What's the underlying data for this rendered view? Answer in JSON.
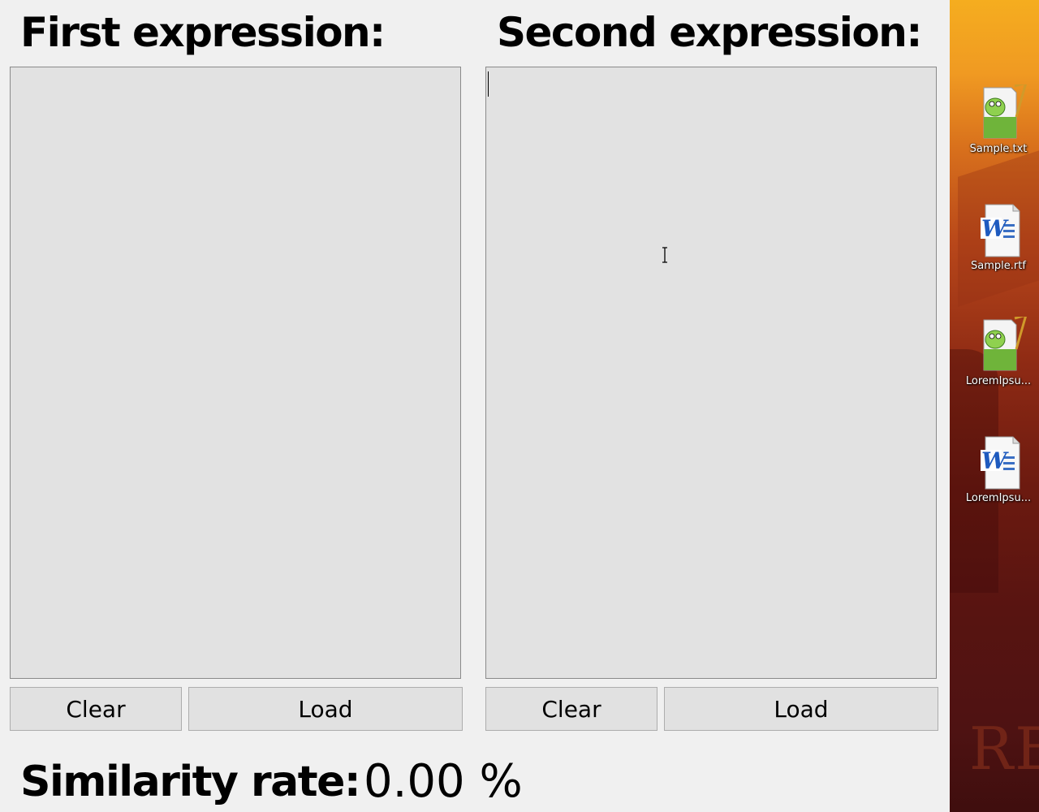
{
  "app": {
    "first_heading": "First expression:",
    "second_heading": "Second expression:",
    "first_panel": {
      "text": "",
      "clear_label": "Clear",
      "load_label": "Load"
    },
    "second_panel": {
      "text": "",
      "clear_label": "Clear",
      "load_label": "Load"
    },
    "similarity_label": "Similarity rate:",
    "similarity_value": "0.00 %"
  },
  "desktop": {
    "icons": [
      {
        "label": "Sample.txt",
        "icon": "notepad-plus-plus-icon"
      },
      {
        "label": "Sample.rtf",
        "icon": "word-document-icon"
      },
      {
        "label": "LoremIpsu...",
        "icon": "notepad-plus-plus-icon"
      },
      {
        "label": "LoremIpsu...",
        "icon": "word-document-icon"
      }
    ],
    "wallpaper_text": "RE",
    "colors": {
      "wallpaper_top": "#f5ad1f",
      "wallpaper_bottom": "#3f0e0e"
    }
  }
}
